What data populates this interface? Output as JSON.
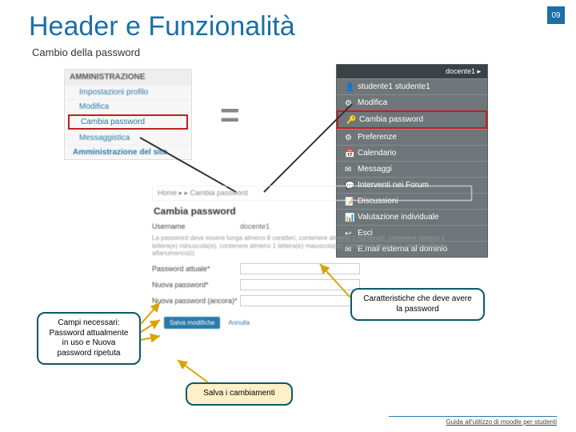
{
  "page_number": "09",
  "title": "Header e Funzionalità",
  "subtitle": "Cambio della password",
  "equals": "=",
  "admin": {
    "heading": "AMMINISTRAZIONE",
    "items": [
      "Impostazioni profilo",
      "Modifica",
      "Cambia password",
      "Messaggistica"
    ],
    "site": "Amministrazione del sito"
  },
  "user_menu": {
    "header_right": "docente1 ▸",
    "items": [
      "studente1 studente1",
      "Modifica",
      "Cambia password",
      "Preferenze",
      "Calendario",
      "Messaggi",
      "Interventi nei Forum",
      "Discussioni",
      "Valutazione individuale",
      "Esci",
      "E.mail esterna al dominio"
    ]
  },
  "form": {
    "breadcrumb": "Home ▸ ▸ Cambia password",
    "title": "Cambia password",
    "username_label": "Username",
    "username_value": "docente1",
    "help": "La password deve essere lunga almeno 8 caratteri, contenere almeno 1 numero(i), contenere almeno 1 lettera(e) minuscola(e), contenere almeno 1 lettera(e) maiuscola(e), contenere almeno 1 carattere(i) non alfanumerico(i)",
    "field1": "Password attuale*",
    "field2": "Nuova password*",
    "field3": "Nuova password (ancora)*",
    "save": "Salva modifiche",
    "cancel": "Annulla"
  },
  "callouts": {
    "left": "Campi necessari: Password attualmente in uso e Nuova password ripetuta",
    "right": "Caratteristiche che deve avere la password",
    "bottom": "Salva i cambiamenti"
  },
  "footer": "Guida all'utilizzo di moodle per studenti"
}
